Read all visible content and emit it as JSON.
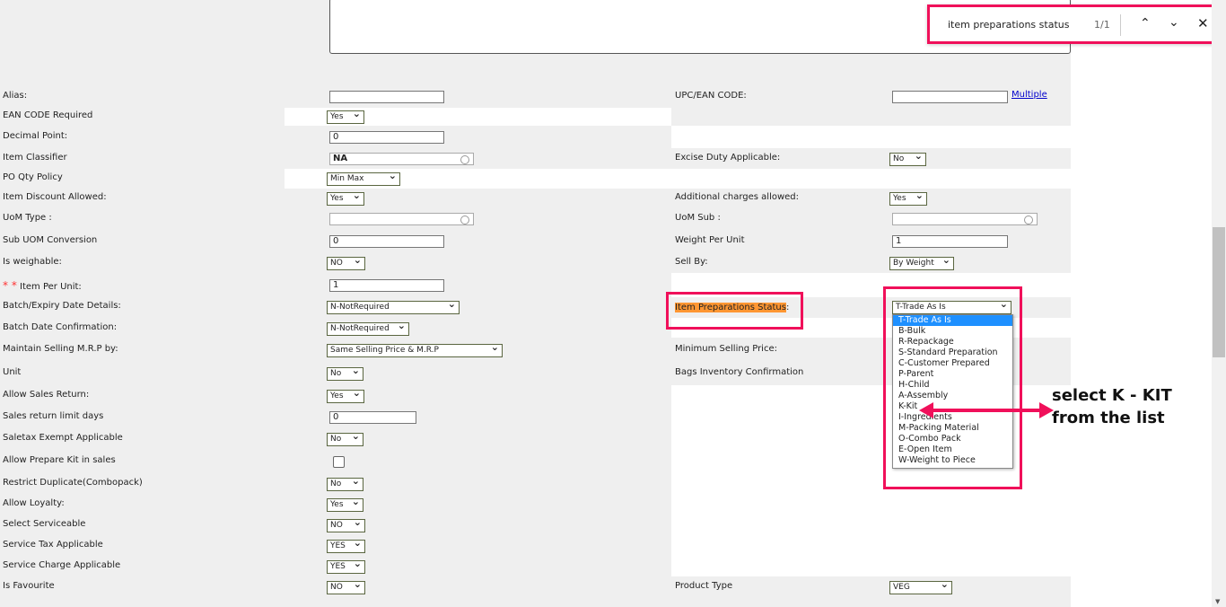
{
  "find_bar": {
    "query": "item preparations status",
    "count": "1/1"
  },
  "left_rows": [
    {
      "label": "Alias:",
      "type": "input",
      "value": "",
      "w": 128
    },
    {
      "label": "EAN CODE Required",
      "type": "select",
      "value": "Yes",
      "w": 42
    },
    {
      "label": "Decimal Point:",
      "type": "input",
      "value": "0",
      "w": 128
    },
    {
      "label": "Item Classifier",
      "type": "lookup",
      "value": "NA",
      "w": 161
    },
    {
      "label": "PO Qty Policy",
      "type": "select",
      "value": "Min Max",
      "w": 82
    },
    {
      "label": "Item Discount Allowed:",
      "type": "select",
      "value": "Yes",
      "w": 42
    },
    {
      "label": "UoM Type :",
      "type": "lookup",
      "value": "",
      "w": 161
    },
    {
      "label": "Sub UOM Conversion",
      "type": "input",
      "value": "0",
      "w": 128
    },
    {
      "label": "Is weighable:",
      "type": "select",
      "value": "NO",
      "w": 43
    },
    {
      "label": "Item Per Unit:",
      "type": "input",
      "value": "1",
      "w": 128,
      "required": "* *"
    },
    {
      "label": "Batch/Expiry Date Details:",
      "type": "select",
      "value": "N-NotRequired",
      "w": 148
    },
    {
      "label": "Batch Date Confirmation:",
      "type": "select",
      "value": "N-NotRequired",
      "w": 92
    },
    {
      "label": "Maintain Selling M.R.P by:",
      "type": "select",
      "value": "Same Selling Price & M.R.P",
      "w": 196
    },
    {
      "label": "Unit",
      "type": "select",
      "value": "No",
      "w": 41
    },
    {
      "label": "Allow Sales Return:",
      "type": "select",
      "value": "Yes",
      "w": 42
    },
    {
      "label": "Sales return limit days",
      "type": "input",
      "value": "0",
      "w": 97
    },
    {
      "label": "Saletax Exempt Applicable",
      "type": "select",
      "value": "No",
      "w": 41
    },
    {
      "label": "Allow Prepare Kit in sales",
      "type": "checkbox",
      "value": "",
      "w": 12
    },
    {
      "label": "Restrict Duplicate(Combopack)",
      "type": "select",
      "value": "No",
      "w": 41
    },
    {
      "label": "Allow Loyalty:",
      "type": "select",
      "value": "Yes",
      "w": 41
    },
    {
      "label": "Select Serviceable",
      "type": "select",
      "value": "NO",
      "w": 43
    },
    {
      "label": "Service Tax Applicable",
      "type": "select",
      "value": "YES",
      "w": 43
    },
    {
      "label": "Service Charge Applicable",
      "type": "select",
      "value": "YES",
      "w": 43
    },
    {
      "label": "Is Favourite",
      "type": "select",
      "value": "NO",
      "w": 43
    }
  ],
  "right_rows": [
    {
      "row": 0,
      "label": "UPC/EAN CODE:",
      "type": "input",
      "value": "",
      "w": 129,
      "link": "Multiple"
    },
    {
      "row": 3,
      "label": "Excise Duty Applicable:",
      "type": "select",
      "value": "No",
      "w": 41
    },
    {
      "row": 5,
      "label": "Additional charges allowed:",
      "type": "select",
      "value": "Yes",
      "w": 42
    },
    {
      "row": 6,
      "label": "UoM Sub :",
      "type": "lookup",
      "value": "",
      "w": 162
    },
    {
      "row": 7,
      "label": "Weight Per Unit",
      "type": "input",
      "value": "1",
      "w": 129
    },
    {
      "row": 8,
      "label": "Sell By:",
      "type": "select",
      "value": "By Weight",
      "w": 72
    },
    {
      "row": 12,
      "label": "Minimum Selling Price:",
      "type": "none"
    },
    {
      "row": 13,
      "label": "Bags Inventory Confirmation",
      "type": "none"
    },
    {
      "row": 23,
      "label": "Product Type",
      "type": "select",
      "value": "VEG",
      "w": 70
    }
  ],
  "item_prep": {
    "label": "Item Preparations Status",
    "colon": ":",
    "selected": "T-Trade As Is",
    "options": [
      "T-Trade As Is",
      "B-Bulk",
      "R-Repackage",
      "S-Standard Preparation",
      "C-Customer Prepared",
      "P-Parent",
      "H-Child",
      "A-Assembly",
      "K-Kit",
      "I-Ingredients",
      "M-Packing Material",
      "O-Combo Pack",
      "E-Open Item",
      "W-Weight to Piece"
    ]
  },
  "annotation": {
    "line1": "select K - KIT",
    "line2": "from the list"
  },
  "colors": {
    "highlight": "#f0105a",
    "accent": "#1e90ff",
    "find_match": "#ff9632"
  }
}
